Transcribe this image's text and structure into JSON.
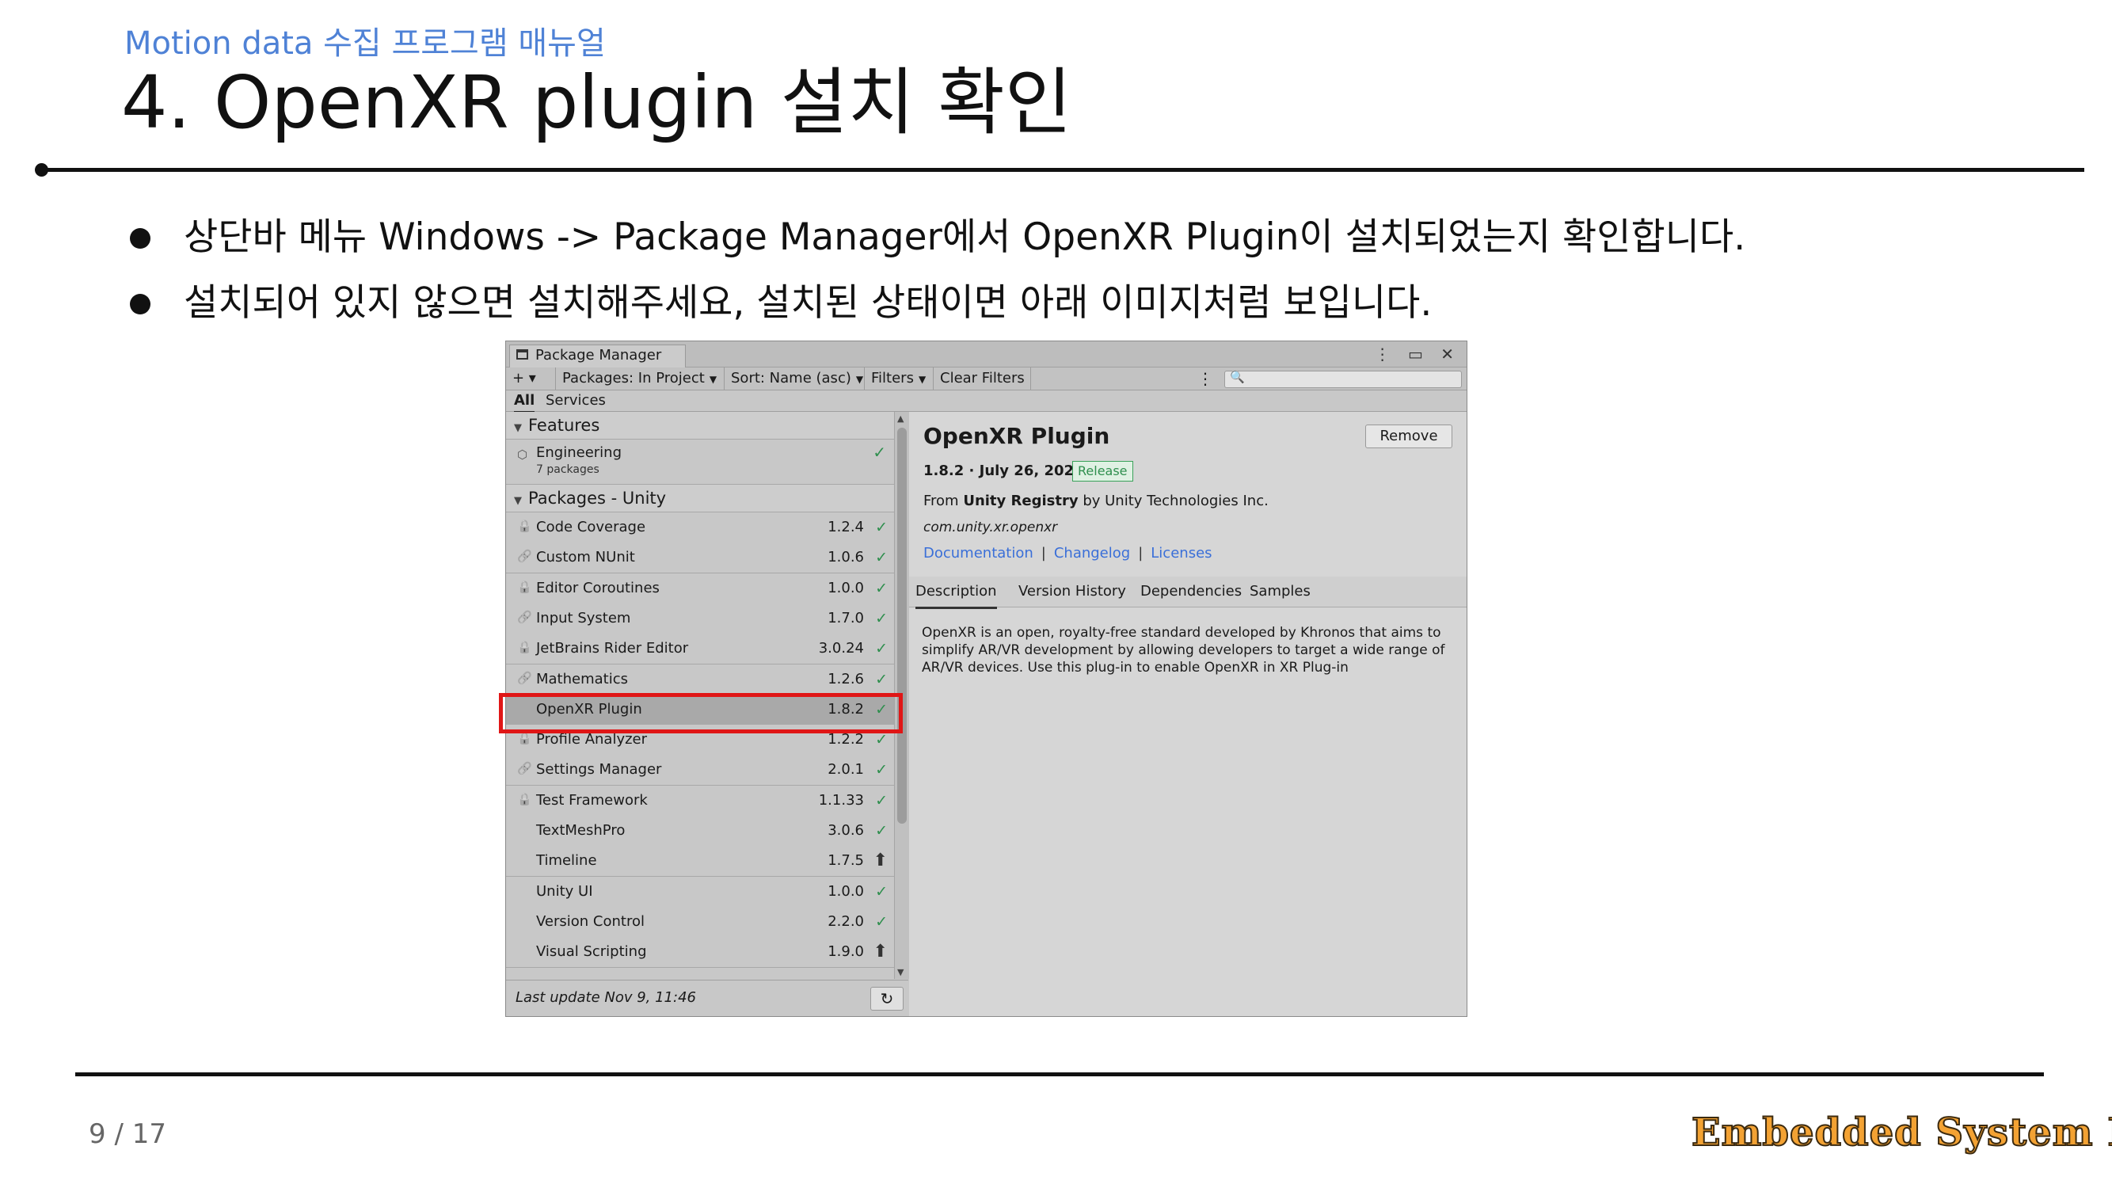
{
  "slide": {
    "subtitle": "Motion data 수집 프로그램 매뉴얼",
    "title": "4. OpenXR plugin 설치 확인",
    "bullets": [
      "상단바 메뉴 Windows -> Package Manager에서 OpenXR Plugin이 설치되었는지 확인합니다.",
      "설치되어 있지 않으면 설치해주세요, 설치된 상태이면 아래 이미지처럼 보입니다."
    ],
    "page_number": "9 / 17",
    "logo_text": "Embedded System Lab"
  },
  "package_manager": {
    "window_title": "Package Manager",
    "window_controls": "⋮ ▭ ✕",
    "toolbar": {
      "add": "+ ▾",
      "packages_filter": "Packages: In Project",
      "sort": "Sort: Name (asc)",
      "filters": "Filters",
      "clear_filters": "Clear Filters",
      "kebab": "⋮",
      "search_placeholder": "🔍"
    },
    "scope": {
      "all": "All",
      "services": "Services"
    },
    "features_header": "Features",
    "feature": {
      "name": "Engineering",
      "count": "7 packages"
    },
    "packages_header": "Packages - Unity",
    "packages": [
      {
        "name": "Code Coverage",
        "version": "1.2.4",
        "icon": "lock-icon",
        "status": "✓"
      },
      {
        "name": "Custom NUnit",
        "version": "1.0.6",
        "icon": "link-icon",
        "status": "✓"
      },
      {
        "name": "Editor Coroutines",
        "version": "1.0.0",
        "icon": "lock-icon",
        "status": "✓"
      },
      {
        "name": "Input System",
        "version": "1.7.0",
        "icon": "link-icon",
        "status": "✓"
      },
      {
        "name": "JetBrains Rider Editor",
        "version": "3.0.24",
        "icon": "lock-icon",
        "status": "✓"
      },
      {
        "name": "Mathematics",
        "version": "1.2.6",
        "icon": "link-icon",
        "status": "✓"
      },
      {
        "name": "OpenXR Plugin",
        "version": "1.8.2",
        "icon": "",
        "status": "✓"
      },
      {
        "name": "Profile Analyzer",
        "version": "1.2.2",
        "icon": "lock-icon",
        "status": "✓"
      },
      {
        "name": "Settings Manager",
        "version": "2.0.1",
        "icon": "link-icon",
        "status": "✓"
      },
      {
        "name": "Test Framework",
        "version": "1.1.33",
        "icon": "lock-icon",
        "status": "✓"
      },
      {
        "name": "TextMeshPro",
        "version": "3.0.6",
        "icon": "",
        "status": "✓"
      },
      {
        "name": "Timeline",
        "version": "1.7.5",
        "icon": "",
        "status": "⬆"
      },
      {
        "name": "Unity UI",
        "version": "1.0.0",
        "icon": "",
        "status": "✓"
      },
      {
        "name": "Version Control",
        "version": "2.2.0",
        "icon": "",
        "status": "✓"
      },
      {
        "name": "Visual Scripting",
        "version": "1.9.0",
        "icon": "",
        "status": "⬆"
      }
    ],
    "footer": {
      "last_update": "Last update Nov 9, 11:46",
      "refresh": "↻"
    },
    "detail": {
      "name": "OpenXR Plugin",
      "remove_label": "Remove",
      "version_date": "1.8.2 · July 26, 2023",
      "badge": "Release",
      "from_prefix": "From ",
      "registry": "Unity Registry",
      "from_suffix": " by Unity Technologies Inc.",
      "package_id": "com.unity.xr.openxr",
      "links": [
        "Documentation",
        "Changelog",
        "Licenses"
      ],
      "tabs": [
        "Description",
        "Version History",
        "Dependencies",
        "Samples"
      ],
      "description": "OpenXR is an open, royalty-free standard developed by Khronos that aims to simplify AR/VR development by allowing developers to target a wide range of AR/VR devices. Use this plug-in to enable OpenXR in XR Plug-in"
    }
  }
}
